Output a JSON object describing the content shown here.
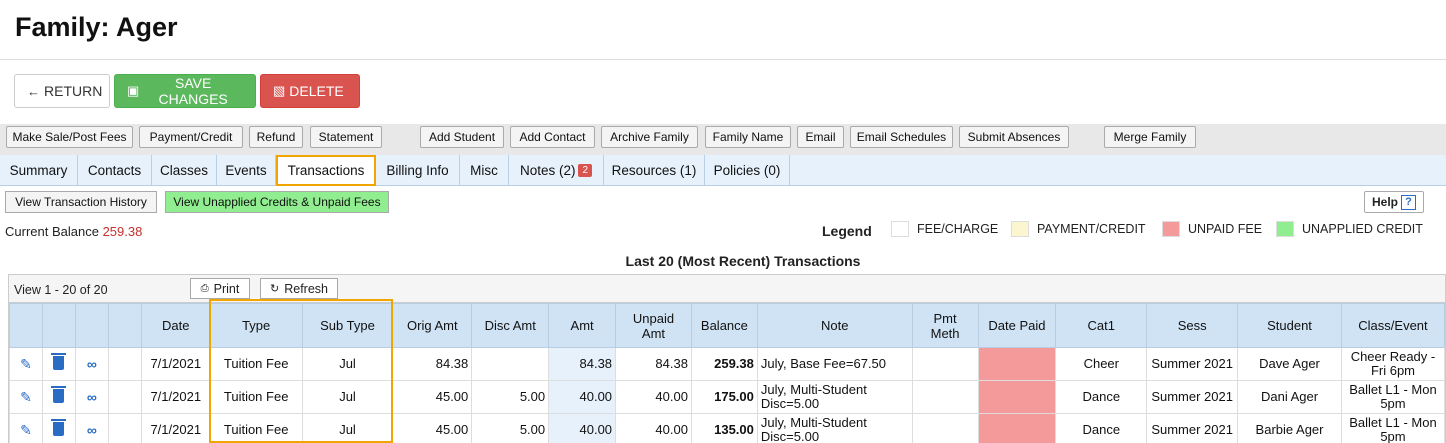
{
  "page": {
    "title": "Family: Ager"
  },
  "actions": {
    "return": "RETURN",
    "save": "SAVE CHANGES",
    "delete": "DELETE"
  },
  "toolbar": {
    "make_sale": "Make Sale/Post Fees",
    "payment_credit": "Payment/Credit",
    "refund": "Refund",
    "statement": "Statement",
    "add_student": "Add Student",
    "add_contact": "Add Contact",
    "archive_family": "Archive Family",
    "family_name": "Family Name",
    "email": "Email",
    "email_schedules": "Email Schedules",
    "submit_absences": "Submit Absences",
    "merge_family": "Merge Family"
  },
  "tabs": {
    "summary": "Summary",
    "contacts": "Contacts",
    "classes": "Classes",
    "events": "Events",
    "transactions": "Transactions",
    "billing": "Billing Info",
    "misc": "Misc",
    "notes": "Notes (2)",
    "notes_badge": "2",
    "resources": "Resources (1)",
    "policies": "Policies (0)"
  },
  "subbar": {
    "history": "View Transaction History",
    "unapplied": "View Unapplied Credits & Unpaid Fees",
    "help": "Help",
    "help_icon": "?"
  },
  "balance": {
    "label": "Current Balance",
    "value": "259.38"
  },
  "legend": {
    "title": "Legend",
    "fee": "FEE/CHARGE",
    "payment": "PAYMENT/CREDIT",
    "unpaid": "UNPAID FEE",
    "unapplied": "UNAPPLIED CREDIT",
    "colors": {
      "fee": "#ffffff",
      "payment": "#fbf6cf",
      "unpaid": "#f59a9a",
      "unapplied": "#90ee90"
    }
  },
  "grid": {
    "caption": "Last 20 (Most Recent) Transactions",
    "view_text": "View 1 - 20 of 20",
    "print": "Print",
    "refresh": "Refresh",
    "columns": {
      "date": "Date",
      "type": "Type",
      "subtype": "Sub Type",
      "orig": "Orig Amt",
      "disc": "Disc Amt",
      "amt": "Amt",
      "unpaid1": "Unpaid",
      "unpaid2": "Amt",
      "balance": "Balance",
      "note": "Note",
      "pmt1": "Pmt",
      "pmt2": "Meth",
      "datepaid": "Date Paid",
      "cat1": "Cat1",
      "sess": "Sess",
      "student": "Student",
      "class": "Class/Event"
    },
    "rows": [
      {
        "date": "7/1/2021",
        "type": "Tuition Fee",
        "subtype": "Jul",
        "orig": "84.38",
        "disc": "",
        "amt": "84.38",
        "unpaid": "84.38",
        "balance": "259.38",
        "note": "July, Base Fee=67.50",
        "pmt": "",
        "cat1": "Cheer",
        "sess": "Summer 2021",
        "student": "Dave Ager",
        "class": "Cheer Ready - Fri 6pm"
      },
      {
        "date": "7/1/2021",
        "type": "Tuition Fee",
        "subtype": "Jul",
        "orig": "45.00",
        "disc": "5.00",
        "amt": "40.00",
        "unpaid": "40.00",
        "balance": "175.00",
        "note": "July, Multi-Student Disc=5.00",
        "pmt": "",
        "cat1": "Dance",
        "sess": "Summer 2021",
        "student": "Dani Ager",
        "class": "Ballet L1 - Mon 5pm"
      },
      {
        "date": "7/1/2021",
        "type": "Tuition Fee",
        "subtype": "Jul",
        "orig": "45.00",
        "disc": "5.00",
        "amt": "40.00",
        "unpaid": "40.00",
        "balance": "135.00",
        "note": "July, Multi-Student Disc=5.00",
        "pmt": "",
        "cat1": "Dance",
        "sess": "Summer 2021",
        "student": "Barbie Ager",
        "class": "Ballet L1 - Mon 5pm"
      }
    ]
  }
}
